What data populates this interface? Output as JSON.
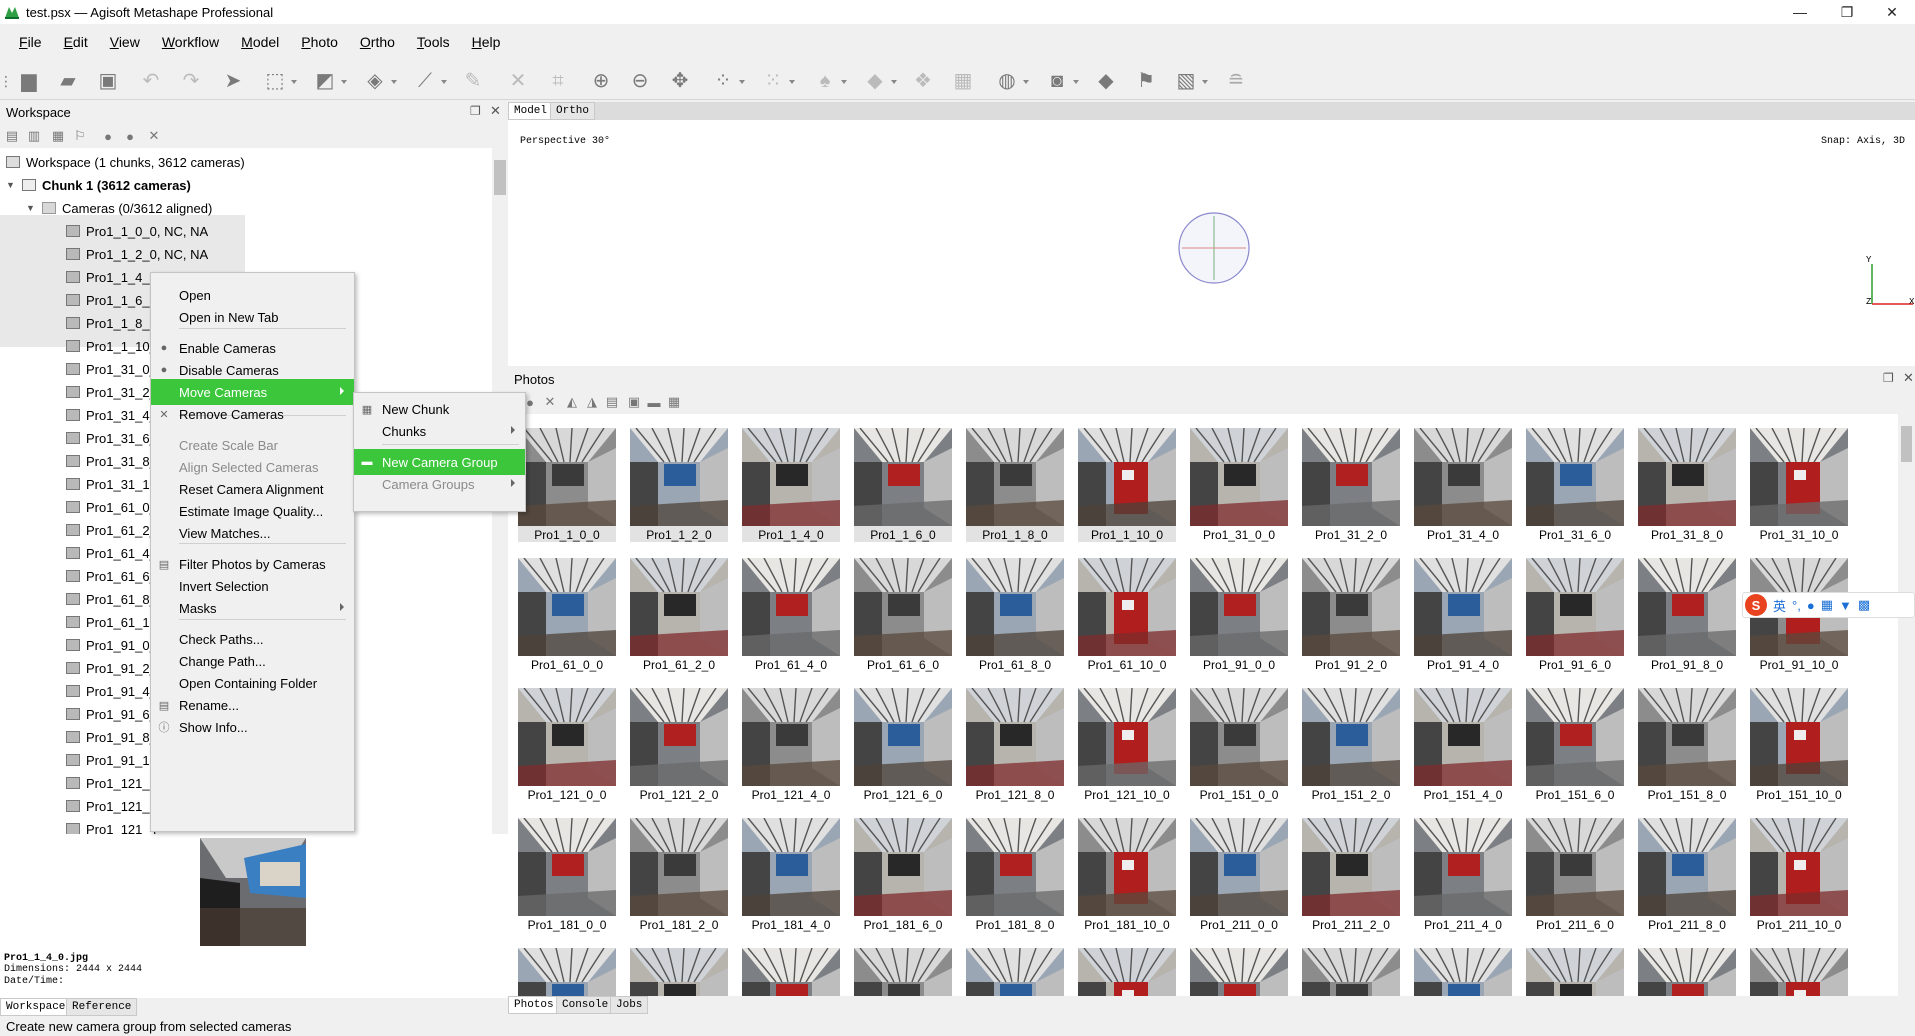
{
  "window": {
    "title": "test.psx — Agisoft Metashape Professional",
    "minimize": "—",
    "maximize": "❐",
    "close": "✕"
  },
  "menu": [
    "File",
    "Edit",
    "View",
    "Workflow",
    "Model",
    "Photo",
    "Ortho",
    "Tools",
    "Help"
  ],
  "workspace": {
    "title": "Workspace",
    "root": "Workspace (1 chunks, 3612 cameras)",
    "chunk": "Chunk 1 (3612 cameras)",
    "cameras": "Cameras (0/3612 aligned)",
    "items": [
      "Pro1_1_0_0, NC, NA",
      "Pro1_1_2_0, NC, NA",
      "Pro1_1_4_0, NC, NA",
      "Pro1_1_6_0,",
      "Pro1_1_8_0,",
      "Pro1_1_10_0",
      "Pro1_31_0_0",
      "Pro1_31_2_0",
      "Pro1_31_4_0",
      "Pro1_31_6_0",
      "Pro1_31_8_0",
      "Pro1_31_10",
      "Pro1_61_0_0",
      "Pro1_61_2_0",
      "Pro1_61_4_0",
      "Pro1_61_6_0",
      "Pro1_61_8_0",
      "Pro1_61_10",
      "Pro1_91_0_0",
      "Pro1_91_2_0",
      "Pro1_91_4_0",
      "Pro1_91_6_0",
      "Pro1_91_8_0",
      "Pro1_91_10",
      "Pro1_121_0",
      "Pro1_121_2",
      "Pro1_121_4"
    ]
  },
  "context_menu": {
    "items": [
      "Open",
      "Open in New Tab",
      "Enable Cameras",
      "Disable Cameras",
      "Move Cameras",
      "Remove Cameras",
      "Create Scale Bar",
      "Align Selected Cameras",
      "Reset Camera Alignment",
      "Estimate Image Quality...",
      "View Matches...",
      "Filter Photos by Cameras",
      "Invert Selection",
      "Masks",
      "Check Paths...",
      "Change Path...",
      "Open Containing Folder",
      "Rename...",
      "Show Info..."
    ],
    "submenu": [
      "New Chunk",
      "Chunks",
      "New Camera Group",
      "Camera Groups"
    ]
  },
  "preview": {
    "filename": "Pro1_1_4_0.jpg",
    "dimensions": "Dimensions: 2444 x 2444",
    "datetime": "Date/Time:"
  },
  "left_tabs": [
    "Workspace",
    "Reference"
  ],
  "model": {
    "tabs": [
      "Model",
      "Ortho"
    ],
    "perspective": "Perspective 30°",
    "snap": "Snap: Axis, 3D",
    "axis_y": "Y",
    "axis_z": "Z",
    "axis_x": "X"
  },
  "photos": {
    "title": "Photos",
    "rows": [
      [
        "Pro1_1_0_0",
        "Pro1_1_2_0",
        "Pro1_1_4_0",
        "Pro1_1_6_0",
        "Pro1_1_8_0",
        "Pro1_1_10_0",
        "Pro1_31_0_0",
        "Pro1_31_2_0",
        "Pro1_31_4_0",
        "Pro1_31_6_0",
        "Pro1_31_8_0",
        "Pro1_31_10_0"
      ],
      [
        "Pro1_61_0_0",
        "Pro1_61_2_0",
        "Pro1_61_4_0",
        "Pro1_61_6_0",
        "Pro1_61_8_0",
        "Pro1_61_10_0",
        "Pro1_91_0_0",
        "Pro1_91_2_0",
        "Pro1_91_4_0",
        "Pro1_91_6_0",
        "Pro1_91_8_0",
        "Pro1_91_10_0"
      ],
      [
        "Pro1_121_0_0",
        "Pro1_121_2_0",
        "Pro1_121_4_0",
        "Pro1_121_6_0",
        "Pro1_121_8_0",
        "Pro1_121_10_0",
        "Pro1_151_0_0",
        "Pro1_151_2_0",
        "Pro1_151_4_0",
        "Pro1_151_6_0",
        "Pro1_151_8_0",
        "Pro1_151_10_0"
      ],
      [
        "Pro1_181_0_0",
        "Pro1_181_2_0",
        "Pro1_181_4_0",
        "Pro1_181_6_0",
        "Pro1_181_8_0",
        "Pro1_181_10_0",
        "Pro1_211_0_0",
        "Pro1_211_2_0",
        "Pro1_211_4_0",
        "Pro1_211_6_0",
        "Pro1_211_8_0",
        "Pro1_211_10_0"
      ]
    ]
  },
  "right_tabs": [
    "Photos",
    "Console",
    "Jobs"
  ],
  "ime": {
    "logo": "S",
    "lang": "英"
  },
  "status": "Create new camera group from selected cameras",
  "colors": {
    "highlight": "#3cc63c",
    "accent": "#2ea043"
  }
}
